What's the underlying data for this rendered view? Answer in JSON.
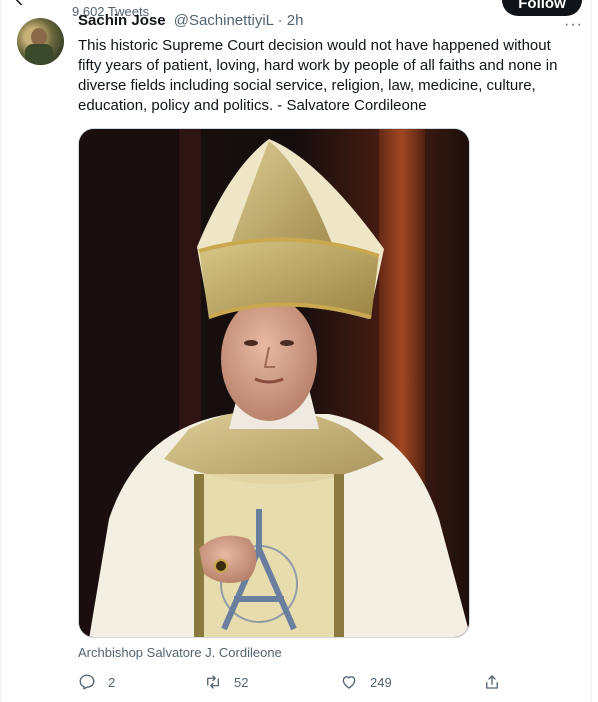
{
  "profile": {
    "tweet_count": "9,602 Tweets",
    "follow_label": "Follow"
  },
  "tweet": {
    "author_name": "Sachin Jose",
    "author_handle": "@SachinettiyiL · 2h",
    "text": "This historic Supreme Court decision would not have happened without fifty years of patient, loving, hard work by people of all faiths and none in diverse fields including social service, religion, law, medicine, culture, education, policy and politics. - Salvatore Cordileone",
    "media_caption": "Archbishop Salvatore J. Cordileone",
    "stats": {
      "replies": "2",
      "retweets": "52",
      "likes": "249"
    }
  },
  "icons": {
    "back": "arrow-left-icon",
    "more": "more-horizontal-icon",
    "reply": "reply-icon",
    "retweet": "retweet-icon",
    "like": "heart-icon",
    "share": "share-icon"
  },
  "colors": {
    "text_primary": "#0f1419",
    "text_secondary": "#536471",
    "border": "#cfd9de"
  }
}
